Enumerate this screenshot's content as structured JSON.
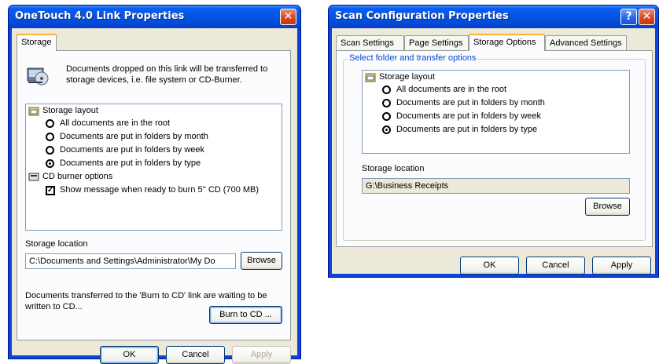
{
  "left": {
    "title": "OneTouch 4.0 Link Properties",
    "close_icon": "close-icon",
    "tab": "Storage",
    "description": "Documents dropped on this link will be transferred to storage devices, i.e. file system or CD-Burner.",
    "tree": {
      "layout_label": "Storage layout",
      "options": [
        {
          "label": "All documents are in the root",
          "selected": false
        },
        {
          "label": "Documents are put in folders by month",
          "selected": false
        },
        {
          "label": "Documents are put in folders by week",
          "selected": false
        },
        {
          "label": "Documents are put in folders by type",
          "selected": true
        }
      ],
      "cd_label": "CD burner options",
      "cd_check_label": "Show message when ready to burn 5'' CD (700 MB)",
      "cd_checked": true
    },
    "storage_location_label": "Storage location",
    "storage_location_value": "C:\\Documents and Settings\\Administrator\\My Do",
    "browse": "Browse",
    "burn_text": "Documents transferred to the 'Burn to CD' link are waiting to be written to CD...",
    "burn_button": "Burn to CD ...",
    "ok": "OK",
    "cancel": "Cancel",
    "apply": "Apply"
  },
  "right": {
    "title": "Scan Configuration Properties",
    "help_glyph": "?",
    "close_icon": "close-icon",
    "tabs": [
      "Scan Settings",
      "Page Settings",
      "Storage Options",
      "Advanced Settings"
    ],
    "active_tab": "Storage Options",
    "group_title": "Select folder and transfer options",
    "tree": {
      "layout_label": "Storage layout",
      "options": [
        {
          "label": "All documents are in the root",
          "selected": false
        },
        {
          "label": "Documents are put in folders by month",
          "selected": false
        },
        {
          "label": "Documents are put in folders by week",
          "selected": false
        },
        {
          "label": "Documents are put in folders by type",
          "selected": true
        }
      ]
    },
    "storage_location_label": "Storage location",
    "storage_location_value": "G:\\Business Receipts",
    "browse": "Browse",
    "ok": "OK",
    "cancel": "Cancel",
    "apply": "Apply"
  },
  "colors": {
    "titlebar": "#0554e3",
    "face": "#ece9d8",
    "group_title": "#0046d5",
    "active_tab_accent": "#f8b537"
  }
}
